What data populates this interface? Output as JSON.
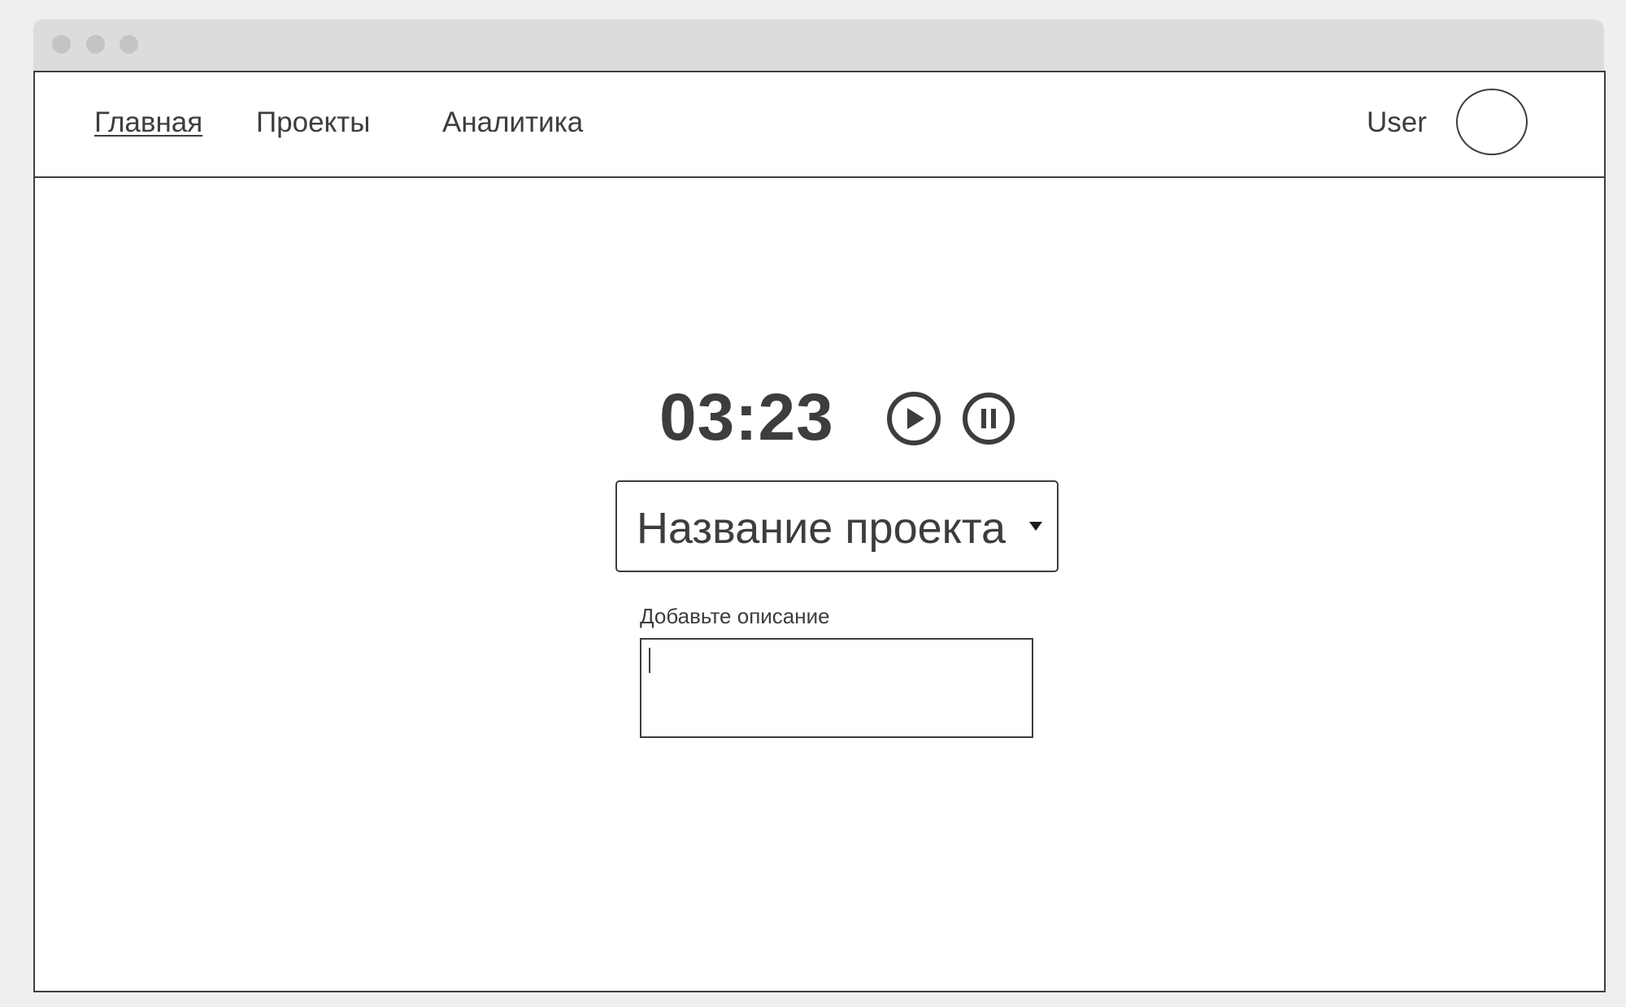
{
  "nav": {
    "items": [
      {
        "label": "Главная",
        "active": true
      },
      {
        "label": "Проекты",
        "active": false
      },
      {
        "label": "Аналитика",
        "active": false
      }
    ]
  },
  "user": {
    "name": "User",
    "avatar_icon": "avatar-circle"
  },
  "timer": {
    "value": "03:23",
    "play_icon": "play-icon",
    "pause_icon": "pause-icon"
  },
  "project_select": {
    "selected": "Название проекта",
    "icon": "dropdown-arrow-icon"
  },
  "description": {
    "label": "Добавьте описание",
    "value": ""
  },
  "colors": {
    "ink": "#3d3d3d",
    "page_bg": "#efefef",
    "titlebar": "#dcdcdc",
    "window_dots": "#c4c4c4"
  }
}
